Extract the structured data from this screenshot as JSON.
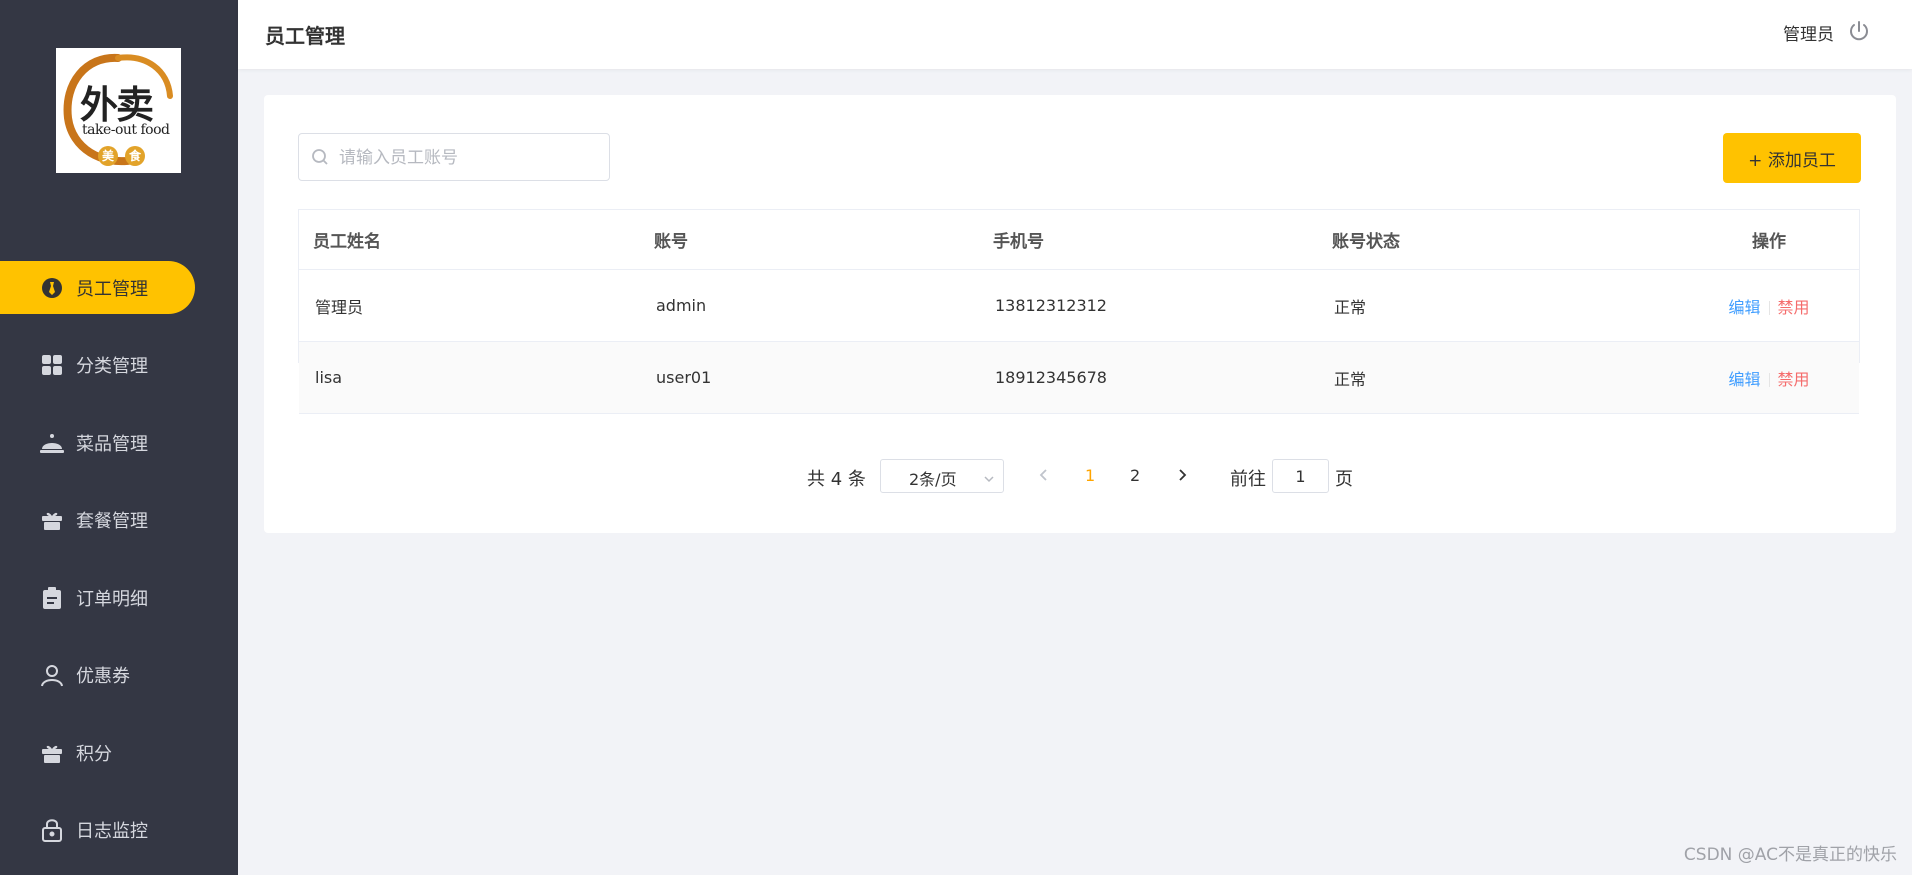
{
  "logo": {
    "word": "外卖",
    "sub": "take-out food",
    "dot1": "美",
    "dot2": "食",
    "icon": "takeout-logo"
  },
  "sidebar": {
    "items": [
      {
        "label": "员工管理",
        "icon": "employee-icon",
        "active": true
      },
      {
        "label": "分类管理",
        "icon": "grid-icon",
        "active": false
      },
      {
        "label": "菜品管理",
        "icon": "cloche-icon",
        "active": false
      },
      {
        "label": "套餐管理",
        "icon": "gift-box-icon",
        "active": false
      },
      {
        "label": "订单明细",
        "icon": "clipboard-icon",
        "active": false
      },
      {
        "label": "优惠券",
        "icon": "person-icon",
        "active": false
      },
      {
        "label": "积分",
        "icon": "gift-icon",
        "active": false
      },
      {
        "label": "日志监控",
        "icon": "lock-icon",
        "active": false
      }
    ]
  },
  "header": {
    "title": "员工管理",
    "user": "管理员",
    "logout_icon": "power-icon"
  },
  "toolbar": {
    "search_placeholder": "请输入员工账号",
    "add_label": "+ 添加员工"
  },
  "table": {
    "columns": [
      "员工姓名",
      "账号",
      "手机号",
      "账号状态",
      "操作"
    ],
    "rows": [
      {
        "name": "管理员",
        "account": "admin",
        "phone": "13812312312",
        "status": "正常",
        "edit": "编辑",
        "disable": "禁用"
      },
      {
        "name": "lisa",
        "account": "user01",
        "phone": "18912345678",
        "status": "正常",
        "edit": "编辑",
        "disable": "禁用"
      }
    ]
  },
  "pagination": {
    "total": "共 4 条",
    "page_size": "2条/页",
    "pages": [
      "1",
      "2"
    ],
    "current": "1",
    "goto_label": "前往",
    "goto_value": "1",
    "goto_suffix": "页"
  },
  "watermark": "CSDN @AC不是真正的快乐",
  "colors": {
    "sidebar": "#343744",
    "accent": "#ffc200",
    "link": "#419eff",
    "danger": "#f56c6c",
    "page_active": "#ffa500"
  }
}
